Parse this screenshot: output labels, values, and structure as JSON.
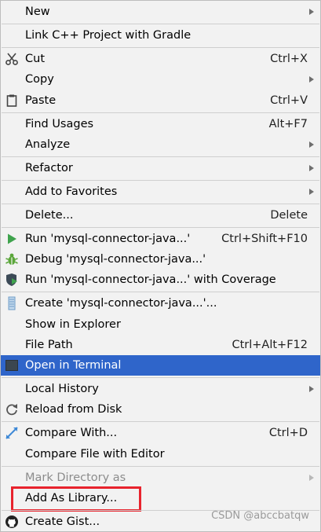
{
  "menu": {
    "new": "New",
    "link_cpp": "Link C++ Project with Gradle",
    "cut": "Cut",
    "cut_shortcut": "Ctrl+X",
    "copy": "Copy",
    "paste": "Paste",
    "paste_shortcut": "Ctrl+V",
    "find_usages": "Find Usages",
    "find_usages_shortcut": "Alt+F7",
    "analyze": "Analyze",
    "refactor": "Refactor",
    "add_to_favorites": "Add to Favorites",
    "delete": "Delete...",
    "delete_shortcut": "Delete",
    "run": "Run 'mysql-connector-java...'",
    "run_shortcut": "Ctrl+Shift+F10",
    "debug": "Debug 'mysql-connector-java...'",
    "run_coverage": "Run 'mysql-connector-java...' with Coverage",
    "create": "Create 'mysql-connector-java...'...",
    "show_in_explorer": "Show in Explorer",
    "file_path": "File Path",
    "file_path_shortcut": "Ctrl+Alt+F12",
    "open_in_terminal": "Open in Terminal",
    "local_history": "Local History",
    "reload_from_disk": "Reload from Disk",
    "compare_with": "Compare With...",
    "compare_with_shortcut": "Ctrl+D",
    "compare_file_editor": "Compare File with Editor",
    "mark_directory_as": "Mark Directory as",
    "add_as_library": "Add As Library...",
    "create_gist": "Create Gist..."
  },
  "watermark": "CSDN @abccbatqw",
  "colors": {
    "selected_bg": "#2f65ca",
    "highlight_border": "#e8232d",
    "run_icon": "#3fa34d",
    "debug_icon": "#5aa63a"
  },
  "icons": {
    "cut": "scissors-icon",
    "paste": "clipboard-icon",
    "run": "play-icon",
    "debug": "bug-icon",
    "coverage": "shield-icon",
    "create": "config-icon",
    "terminal": "terminal-icon",
    "reload": "reload-icon",
    "compare": "compare-icon",
    "gist": "github-icon"
  }
}
